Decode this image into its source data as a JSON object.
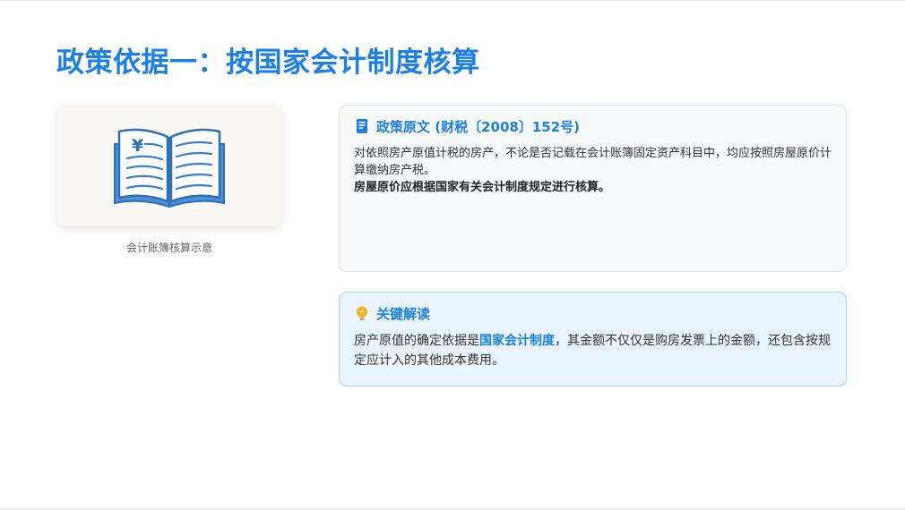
{
  "page": {
    "title": "政策依据一：按国家会计制度核算"
  },
  "illustration": {
    "icon": "open-ledger-book-yen-icon",
    "caption": "会计账簿核算示意",
    "symbol": "¥"
  },
  "policy": {
    "icon": "document-icon",
    "heading": "政策原文 (财税〔2008〕152号)",
    "paragraph1": "对依照房产原值计税的房产，不论是否记载在会计账簿固定资产科目中，均应按照房屋原价计算缴纳房产税。",
    "paragraph2": "房屋原价应根据国家有关会计制度规定进行核算。"
  },
  "insight": {
    "icon": "lightbulb-icon",
    "heading": "关键解读",
    "text_before": "房产原值的确定依据是",
    "highlight": "国家会计制度",
    "text_after": "，其金额不仅仅是购房发票上的金额，还包含按规定应计入的其他成本费用。"
  },
  "colors": {
    "accent": "#1a7fe6",
    "insight_bg": "#eaf4fe",
    "insight_border": "#a9d2f4",
    "bulb": "#f5b21b"
  }
}
